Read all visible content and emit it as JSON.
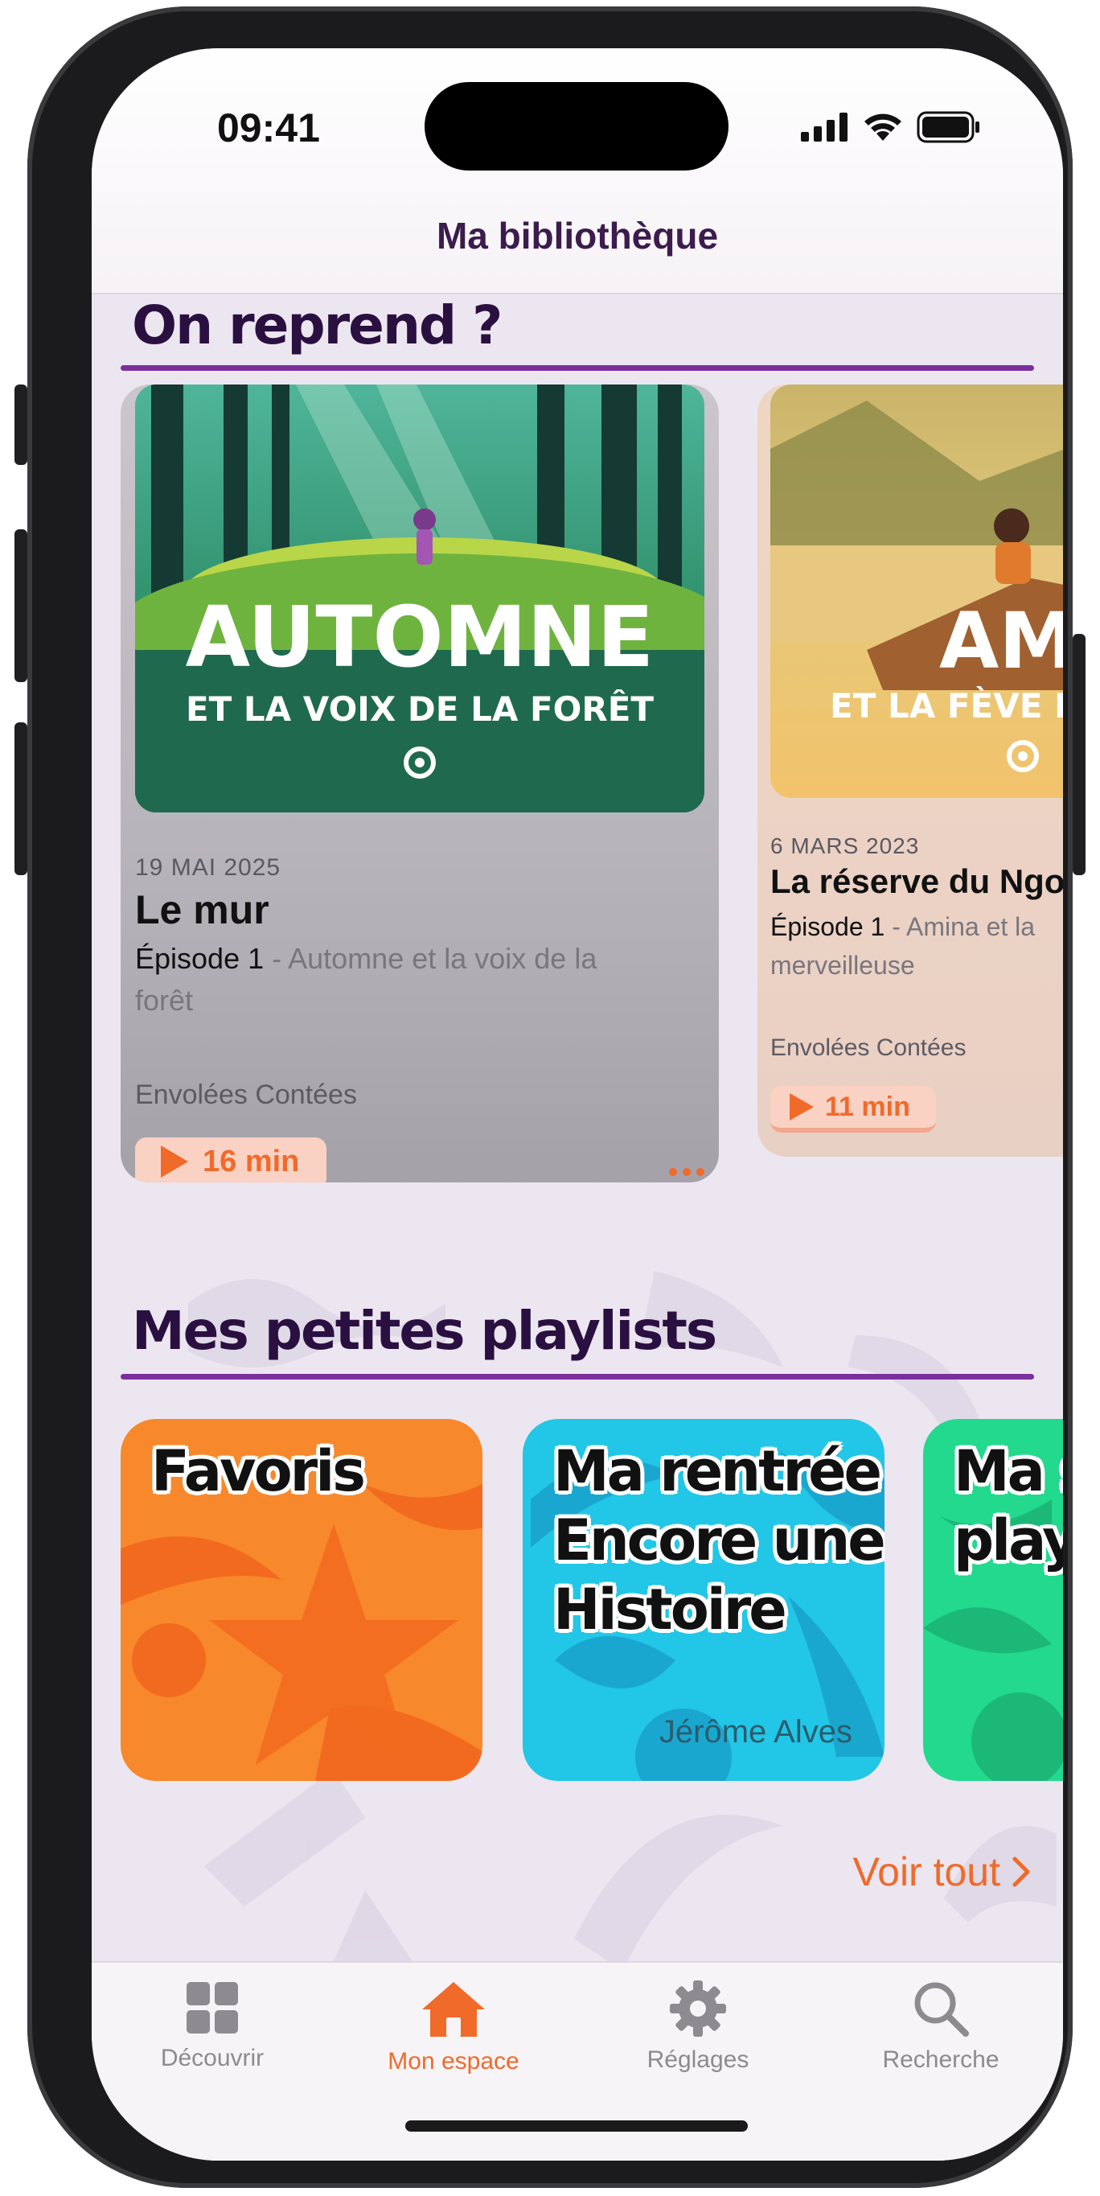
{
  "status": {
    "time": "09:41"
  },
  "nav": {
    "title": "Ma bibliothèque"
  },
  "resume": {
    "title": "On reprend ?",
    "cards": [
      {
        "cover_title": "AUTOMNE",
        "cover_subtitle": "ET LA VOIX DE LA FORÊT",
        "date": "19 MAI 2025",
        "title": "Le mur",
        "episode": "Épisode 1",
        "episode_rest": " - Automne et la voix de la forêt",
        "author": "Envolées Contées",
        "duration": "16 min"
      },
      {
        "cover_title": "AMIN",
        "cover_subtitle": "ET LA FÈVE MERV",
        "date": "6 MARS 2023",
        "title": "La réserve du Ngo",
        "episode": "Épisode 1",
        "episode_rest": " - Amina et la merveilleuse",
        "author": "Envolées Contées",
        "duration": "11 min"
      }
    ]
  },
  "playlists": {
    "title": "Mes petites playlists",
    "items": [
      {
        "title": "Favoris",
        "author": "",
        "color": "#f7882b"
      },
      {
        "title": "Ma rentrée Encore une Histoire",
        "author": "Jérôme Alves",
        "color": "#22c6e6"
      },
      {
        "title": "Ma s play",
        "author": "",
        "color": "#22d98e"
      }
    ],
    "see_all": "Voir tout"
  },
  "tabs": [
    {
      "label": "Découvrir",
      "icon": "grid-icon"
    },
    {
      "label": "Mon espace",
      "icon": "house-icon",
      "active": true
    },
    {
      "label": "Réglages",
      "icon": "gear-icon"
    },
    {
      "label": "Recherche",
      "icon": "search-icon"
    }
  ],
  "colors": {
    "accent": "#f06a2a",
    "section_title": "#2a1040",
    "underline": "#7a2f9c"
  }
}
